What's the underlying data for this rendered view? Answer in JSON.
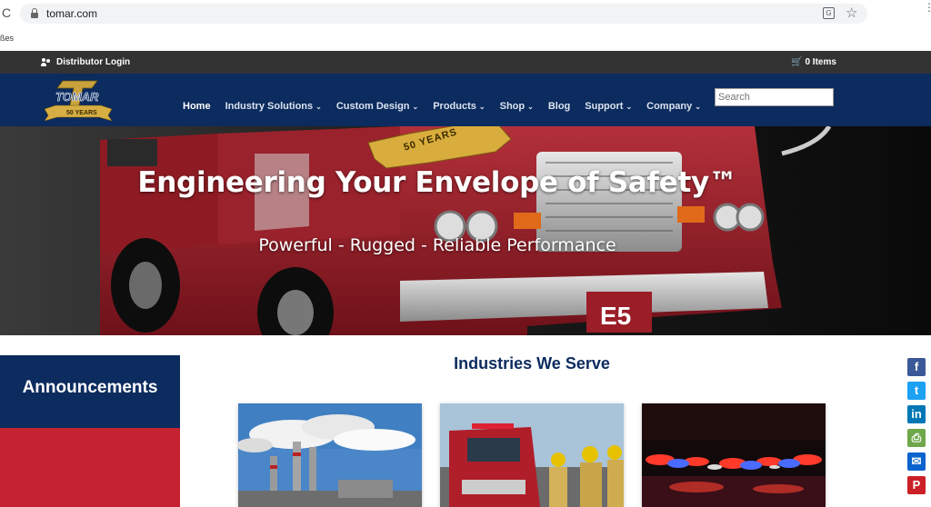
{
  "browser": {
    "url": "tomar.com",
    "bookmark_fragment": "ßes"
  },
  "topbar": {
    "distributor_login": "Distributor Login",
    "cart": "0 Items"
  },
  "logo": {
    "brand": "TOMAR",
    "years": "50 YEARS"
  },
  "nav": {
    "items": [
      {
        "label": "Home",
        "dropdown": false
      },
      {
        "label": "Industry Solutions",
        "dropdown": true
      },
      {
        "label": "Custom Design",
        "dropdown": true
      },
      {
        "label": "Products",
        "dropdown": true
      },
      {
        "label": "Shop",
        "dropdown": true
      },
      {
        "label": "Blog",
        "dropdown": false
      },
      {
        "label": "Support",
        "dropdown": true
      },
      {
        "label": "Company",
        "dropdown": true
      }
    ],
    "chevron": "⌄"
  },
  "search": {
    "placeholder": "Search"
  },
  "hero": {
    "title": "Engineering Your Envelope of Safety™",
    "subtitle": "Powerful - Rugged - Reliable Performance",
    "badge": "50 YEARS",
    "truck_text": "E5"
  },
  "announcements": {
    "title": "Announcements"
  },
  "industries": {
    "title": "Industries We Serve"
  },
  "social": [
    {
      "icon": "facebook-icon",
      "glyph": "f",
      "color": "#3b5998"
    },
    {
      "icon": "twitter-icon",
      "glyph": "t",
      "color": "#1da1f2"
    },
    {
      "icon": "linkedin-icon",
      "glyph": "in",
      "color": "#0077b5"
    },
    {
      "icon": "print-icon",
      "glyph": "⎙",
      "color": "#6fa84a"
    },
    {
      "icon": "email-icon",
      "glyph": "✉",
      "color": "#0b63ce"
    },
    {
      "icon": "pinterest-icon",
      "glyph": "P",
      "color": "#cb2027"
    }
  ],
  "colors": {
    "navy": "#0c2b5e",
    "red": "#c62332",
    "topbar": "#333333"
  }
}
